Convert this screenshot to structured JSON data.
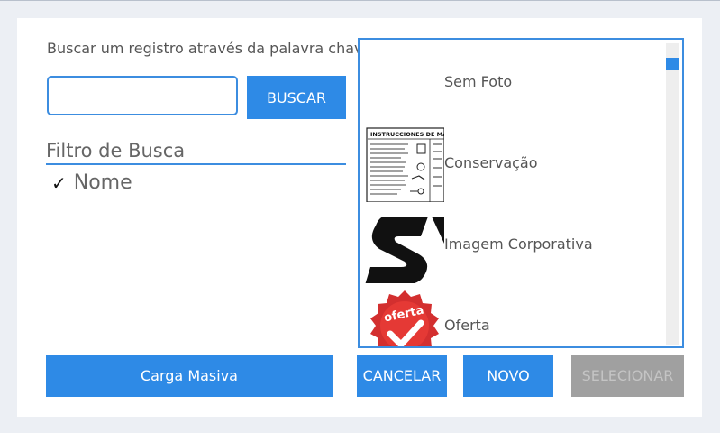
{
  "search": {
    "label": "Buscar um registro através da palavra chave",
    "value": "",
    "placeholder": "",
    "button": "BUSCAR"
  },
  "filter": {
    "title": "Filtro de Busca",
    "items": [
      {
        "label": "Nome",
        "checked": true
      }
    ]
  },
  "list": {
    "items": [
      {
        "label": "Sem Foto",
        "thumb": "none"
      },
      {
        "label": "Conservação",
        "thumb": "instructions-sheet",
        "thumb_text": "INSTRUCCIONES DE MA"
      },
      {
        "label": "Imagem Corporativa",
        "thumb": "logo-s"
      },
      {
        "label": "Oferta",
        "thumb": "oferta-seal",
        "thumb_text": "oferta"
      }
    ],
    "scroll_position": 0
  },
  "footer": {
    "carga_label": "Carga Masiva",
    "cancelar_label": "CANCELAR",
    "novo_label": "NOVO",
    "selecionar_label": "SELECIONAR"
  },
  "colors": {
    "accent": "#2e8ae6",
    "disabled": "#a0a0a0",
    "background": "#eceff4",
    "panel": "#ffffff",
    "oferta_red": "#d32f2f"
  }
}
